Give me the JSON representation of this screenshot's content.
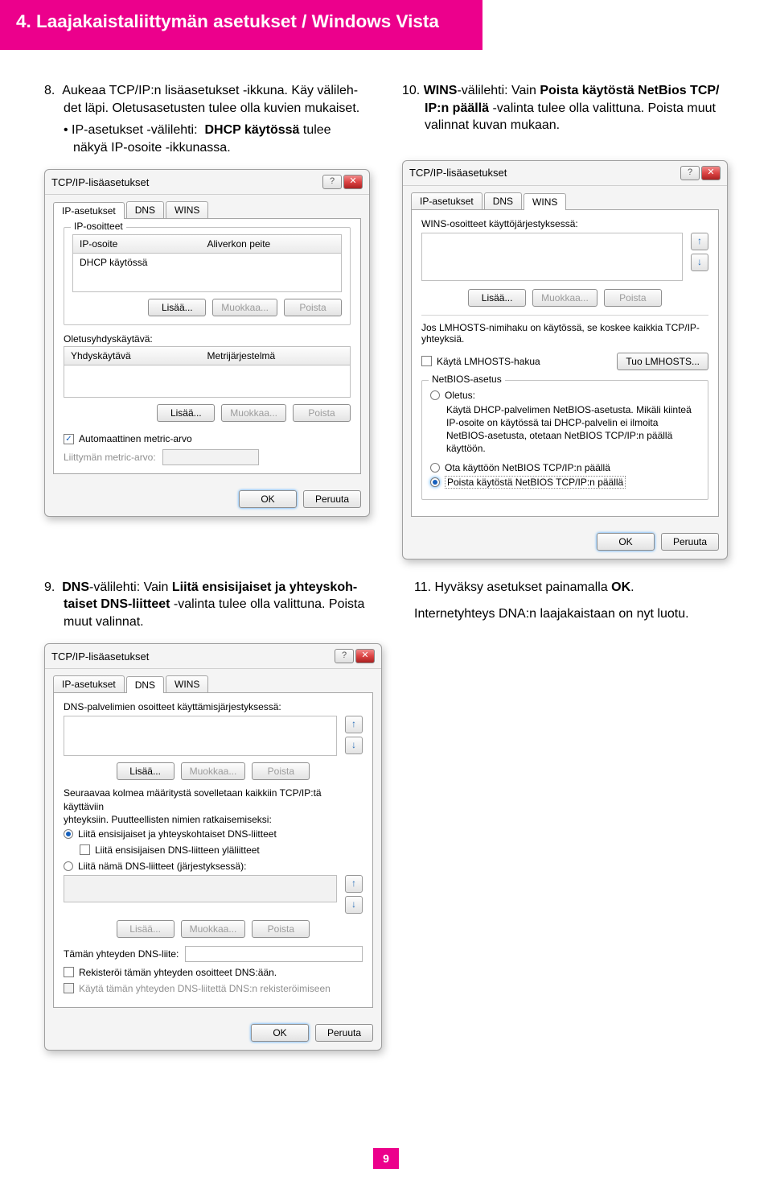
{
  "header": {
    "title": "4. Laajakaistaliittymän asetukset / Windows Vista"
  },
  "step8": {
    "line1_a": "8.  Aukeaa TCP/IP:n lisäasetukset -ikkuna. Käy välileh-",
    "line1_b": "det läpi. Oletusasetusten tulee olla kuvien mukaiset.",
    "bullet_a": "• IP-asetukset -välilehti:  ",
    "bullet_bold": "DHCP käytössä",
    "bullet_b": " tulee",
    "bullet_c": "näkyä IP-osoite -ikkunassa."
  },
  "step10": {
    "a": "10. ",
    "b": "WINS",
    "c": "-välilehti: Vain ",
    "d": "Poista käytöstä NetBios TCP/",
    "e": "IP:n päällä",
    "f": " -valinta tulee olla valittuna. Poista muut",
    "g": "valinnat kuvan mukaan."
  },
  "step9": {
    "a": "9.  ",
    "b": "DNS",
    "c": "-välilehti: Vain ",
    "d": "Liitä ensisijaiset ja yhteyskoh-",
    "e": "taiset DNS-liitteet",
    "f": " -valinta tulee olla valittuna. Poista",
    "g": "muut valinnat."
  },
  "step11": {
    "a": "11. Hyväksy asetukset painamalla ",
    "b": "OK",
    "c": ".",
    "d": "Internetyhteys DNA:n laajakaistaan on nyt luotu."
  },
  "dlg": {
    "title": "TCP/IP-lisäasetukset",
    "tabs": {
      "ip": "IP-asetukset",
      "dns": "DNS",
      "wins": "WINS"
    },
    "ip": {
      "grp_ip": "IP-osoitteet",
      "col_ip": "IP-osoite",
      "col_mask": "Aliverkon peite",
      "dhcp": "DHCP käytössä",
      "grp_gw_label": "Oletusyhdyskäytävä:",
      "col_gw": "Yhdyskäytävä",
      "col_metric": "Metrijärjestelmä",
      "auto_metric": "Automaattinen metric-arvo",
      "metric_label": "Liittymän metric-arvo:"
    },
    "wins": {
      "order_label": "WINS-osoitteet käyttöjärjestyksessä:",
      "lmhosts_note": "Jos LMHOSTS-nimihaku on käytössä, se koskee kaikkia TCP/IP-yhteyksiä.",
      "lmhosts_chk": "Käytä LMHOSTS-hakua",
      "import_btn": "Tuo LMHOSTS...",
      "grp": "NetBIOS-asetus",
      "opt1": "Oletus:",
      "opt1_sub1": "Käytä DHCP-palvelimen NetBIOS-asetusta. Mikäli kiinteä",
      "opt1_sub2": "IP-osoite on käytössä tai DHCP-palvelin ei ilmoita",
      "opt1_sub3": "NetBIOS-asetusta, otetaan NetBIOS TCP/IP:n päällä käyttöön.",
      "opt2": "Ota käyttöön NetBIOS TCP/IP:n päällä",
      "opt3": "Poista käytöstä NetBIOS TCP/IP:n päällä"
    },
    "dns": {
      "order_label": "DNS-palvelimien osoitteet käyttämisjärjestyksessä:",
      "note1": "Seuraavaa kolmea määritystä sovelletaan kaikkiin TCP/IP:tä käyttäviin",
      "note2": "yhteyksiin. Puutteellisten nimien ratkaisemiseksi:",
      "opt1": "Liitä ensisijaiset ja yhteyskohtaiset DNS-liitteet",
      "opt1_sub": "Liitä ensisijaisen DNS-liitteen yläliitteet",
      "opt2": "Liitä nämä DNS-liitteet (järjestyksessä):",
      "suffix_label": "Tämän yhteyden DNS-liite:",
      "reg": "Rekisteröi tämän yhteyden osoitteet DNS:ään.",
      "reguse": "Käytä tämän yhteyden DNS-liitettä DNS:n rekisteröimiseen"
    },
    "btn": {
      "add": "Lisää...",
      "edit": "Muokkaa...",
      "del": "Poista",
      "ok": "OK",
      "cancel": "Peruuta"
    }
  },
  "page": "9"
}
